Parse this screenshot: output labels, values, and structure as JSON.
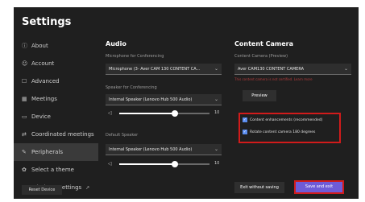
{
  "settings": {
    "title": "Settings",
    "nav": [
      {
        "label": "About",
        "icon": "info-icon"
      },
      {
        "label": "Account",
        "icon": "person-icon"
      },
      {
        "label": "Advanced",
        "icon": "gear-icon"
      },
      {
        "label": "Meetings",
        "icon": "calendar-icon"
      },
      {
        "label": "Device",
        "icon": "monitor-icon"
      },
      {
        "label": "Coordinated meetings",
        "icon": "link-icon"
      },
      {
        "label": "Peripherals",
        "icon": "peripherals-icon"
      },
      {
        "label": "Select a theme",
        "icon": "palette-icon"
      },
      {
        "label": "Windows Settings",
        "icon": "windows-icon"
      }
    ],
    "reset_label": "Reset Device"
  },
  "audio": {
    "title": "Audio",
    "mic_label": "Microphone for Conferencing",
    "mic_value": "Microphone (3- Aver CAM 130 CONTENT CA...",
    "speaker_label": "Speaker for Conferencing",
    "speaker_value": "Internal Speaker (Lenovo Hub 500 Audio)",
    "speaker_volume": 10,
    "default_label": "Default Speaker",
    "default_value": "Internal Speaker (Lenovo Hub 500 Audio)",
    "default_volume": 10
  },
  "camera": {
    "title": "Content Camera",
    "cam_label": "Content Camera (Preview)",
    "cam_value": "Aver CAM130 CONTENT CAMERA",
    "warning": "This content camera is not certified. Learn more",
    "preview_label": "Preview",
    "option1": "Content enhancements (recommended)",
    "option2": "Rotate content camera 180 degrees"
  },
  "footer": {
    "exit_label": "Exit without saving",
    "save_label": "Save and exit"
  },
  "colors": {
    "background": "#1f1f1f",
    "accent": "#6e5bd8",
    "highlight": "#d11b1b"
  }
}
